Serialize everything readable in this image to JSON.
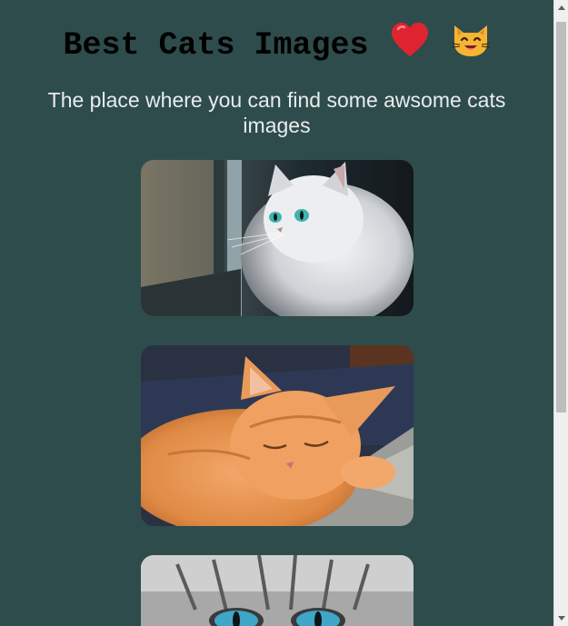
{
  "header": {
    "title": "Best Cats Images",
    "emojis": [
      "heart-emoji",
      "cat-face-emoji"
    ]
  },
  "intro": {
    "subtitle": "The place where you can find some awsome cats images"
  },
  "gallery": {
    "images": [
      {
        "subject": "white fluffy cat looking out window",
        "icon": "cat-photo"
      },
      {
        "subject": "orange tabby cat sleeping on blanket",
        "icon": "cat-photo"
      },
      {
        "subject": "grey cat with blue eyes close-up",
        "icon": "cat-photo"
      }
    ]
  },
  "colors": {
    "page_background": "#2f4c4c",
    "title": "#000000",
    "subtitle": "#e8ecec"
  }
}
